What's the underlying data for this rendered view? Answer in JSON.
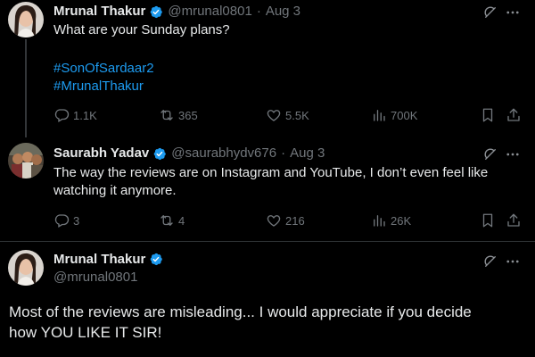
{
  "colors": {
    "background": "#000000",
    "text": "#e7e9ea",
    "muted": "#71767b",
    "link": "#1d9bf0",
    "verified": "#1d9bf0"
  },
  "tweet1": {
    "name": "Mrunal Thakur",
    "handle": "@mrunal0801",
    "separator": "·",
    "date": "Aug 3",
    "text": "What are your Sunday plans?",
    "hashtags": [
      "#SonOfSardaar2",
      "#MrunalThakur"
    ],
    "stats": {
      "replies": "1.1K",
      "retweets": "365",
      "likes": "5.5K",
      "views": "700K"
    }
  },
  "tweet2": {
    "name": "Saurabh Yadav",
    "handle": "@saurabhydv676",
    "separator": "·",
    "date": "Aug 3",
    "text_line1": "The way the reviews are on Instagram and YouTube, I don’t even feel like",
    "text_line2": "watching it anymore.",
    "stats": {
      "replies": "3",
      "retweets": "4",
      "likes": "216",
      "views": "26K"
    }
  },
  "tweet3": {
    "name": "Mrunal Thakur",
    "handle": "@mrunal0801",
    "text_line1": "Most of the reviews are misleading...  I would appreciate if you decide",
    "text_line2": "how YOU LIKE IT SIR!"
  },
  "icons": {
    "grok": "grok-icon",
    "more": "more-options-icon",
    "reply": "reply-icon",
    "retweet": "retweet-icon",
    "like": "heart-icon",
    "views": "views-chart-icon",
    "bookmark": "bookmark-icon",
    "share": "share-icon",
    "verified": "verified-badge-icon"
  }
}
